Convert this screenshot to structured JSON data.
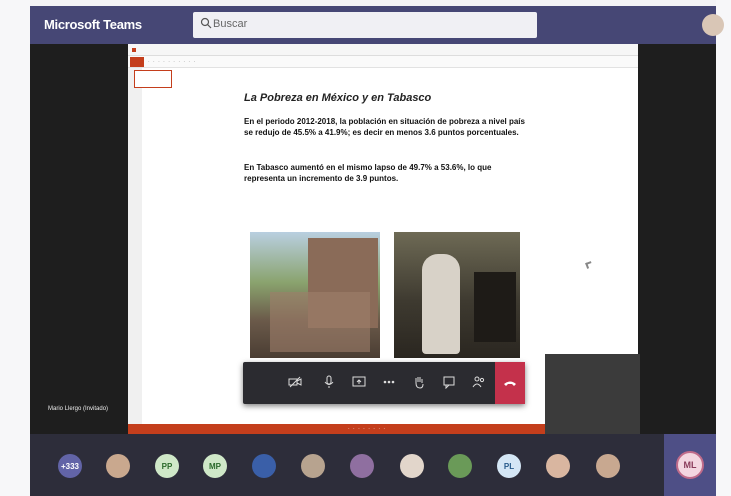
{
  "app": {
    "title": "Microsoft Teams"
  },
  "search": {
    "placeholder": "Buscar"
  },
  "slide": {
    "title": "La Pobreza en México y en Tabasco",
    "paragraph1": "En el periodo 2012-2018, la población en situación de pobreza a nivel país se redujo de 45.5% a 41.9%; es decir en menos 3.6 puntos porcentuales.",
    "paragraph2": "En Tabasco aumentó en el mismo lapso de 49.7% a 53.6%, lo que representa un incremento de 3.9 puntos."
  },
  "presenter": {
    "name": "Mario Llergo (Invitado)"
  },
  "controls": [
    "camera-toggle",
    "mic-toggle",
    "share-tray",
    "more-actions",
    "raise-hand",
    "chat",
    "participants",
    "hang-up"
  ],
  "tray": {
    "overflow_count": "+333",
    "participants": [
      {
        "initials": "",
        "kind": "photo",
        "color": "#c9a88e"
      },
      {
        "initials": "PP",
        "kind": "initials",
        "color": "#cfe8c8"
      },
      {
        "initials": "MP",
        "kind": "initials",
        "color": "#cfe8c8"
      },
      {
        "initials": "",
        "kind": "photo",
        "color": "#3a5fa8"
      },
      {
        "initials": "",
        "kind": "photo",
        "color": "#b7a38f"
      },
      {
        "initials": "",
        "kind": "photo",
        "color": "#8f6fa0"
      },
      {
        "initials": "",
        "kind": "photo",
        "color": "#e2d6cb"
      },
      {
        "initials": "",
        "kind": "photo",
        "color": "#6a9a58"
      },
      {
        "initials": "PL",
        "kind": "initials",
        "color": "#d4e6f5"
      },
      {
        "initials": "",
        "kind": "photo",
        "color": "#d9b6a0"
      },
      {
        "initials": "",
        "kind": "photo",
        "color": "#c8a890"
      }
    ],
    "me_initials": "ML"
  },
  "colors": {
    "teams_purple": "#464775",
    "ppt_orange": "#c43e1c",
    "hangup_red": "#c4314b"
  }
}
